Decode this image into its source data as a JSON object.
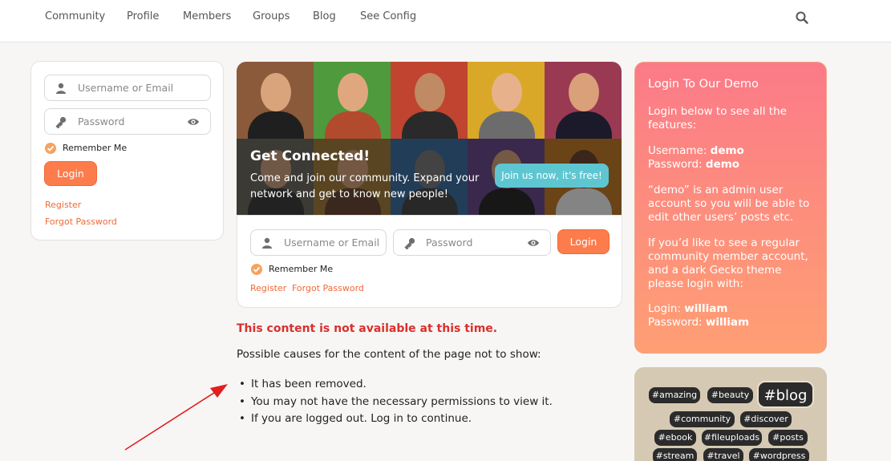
{
  "nav": {
    "items": [
      "Community",
      "Profile",
      "Members",
      "Groups",
      "Blog",
      "See Config"
    ],
    "search_icon": "search-icon"
  },
  "sidebar_login": {
    "username_placeholder": "Username or Email",
    "password_placeholder": "Password",
    "remember_label": "Remember Me",
    "login_label": "Login",
    "register_label": "Register",
    "forgot_label": "Forgot Password"
  },
  "hero": {
    "title": "Get Connected!",
    "text": "Come and join our community. Expand your network and get to know new people!",
    "cta_label": "Join us now, it's free!"
  },
  "main_login": {
    "username_placeholder": "Username or Email",
    "password_placeholder": "Password",
    "login_label": "Login",
    "remember_label": "Remember Me",
    "register_label": "Register",
    "forgot_label": "Forgot Password"
  },
  "notice": {
    "title": "This content is not available at this time.",
    "subtitle": "Possible causes for the content of the page not to show:",
    "causes": [
      "It has been removed.",
      "You may not have the necessary permissions to view it.",
      "If you are logged out. Log in to continue."
    ]
  },
  "promo": {
    "title": "Login To Our Demo",
    "intro": "Login below to see all the features:",
    "username_label": "Username:",
    "username_value": "demo",
    "password_label": "Password:",
    "password_value": "demo",
    "admin_note": "“demo” is an admin user account so you will be able to edit other users’ posts etc.",
    "regular_note": "If you’d like to see a regular community member account, and a dark Gecko theme please login with:",
    "login2_label": "Login:",
    "login2_value": "william",
    "password2_label": "Password:",
    "password2_value": "william"
  },
  "tags": [
    "#amazing",
    "#beauty",
    "#blog",
    "#community",
    "#discover",
    "#ebook",
    "#fileuploads",
    "#posts",
    "#stream",
    "#travel",
    "#wordpress"
  ],
  "colors": {
    "accent": "#fc7c4c",
    "error": "#d9302c",
    "cta": "#5ec6d1"
  }
}
